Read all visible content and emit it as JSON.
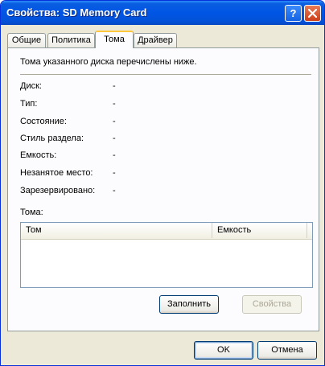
{
  "window": {
    "title": "Свойства: SD Memory Card",
    "help_glyph": "?",
    "close_glyph": "×"
  },
  "tabs": [
    {
      "label": "Общие",
      "active": false
    },
    {
      "label": "Политика",
      "active": false
    },
    {
      "label": "Тома",
      "active": true
    },
    {
      "label": "Драйвер",
      "active": false
    }
  ],
  "panel": {
    "intro": "Тома указанного диска перечислены ниже.",
    "props": [
      {
        "label": "Диск:",
        "value": "-"
      },
      {
        "label": "Тип:",
        "value": "-"
      },
      {
        "label": "Состояние:",
        "value": "-"
      },
      {
        "label": "Стиль раздела:",
        "value": "-"
      },
      {
        "label": "Емкость:",
        "value": "-"
      },
      {
        "label": "Незанятое место:",
        "value": "-"
      },
      {
        "label": "Зарезервировано:",
        "value": "-"
      }
    ],
    "volumes_label": "Тома:",
    "columns": [
      "Том",
      "Емкость"
    ],
    "populate_button": "Заполнить",
    "properties_button": "Свойства"
  },
  "footer": {
    "ok": "OK",
    "cancel": "Отмена"
  },
  "colors": {
    "titlebar": "#0055e5",
    "active_tab_accent": "#ffc83c",
    "close_button": "#cd3f19"
  }
}
